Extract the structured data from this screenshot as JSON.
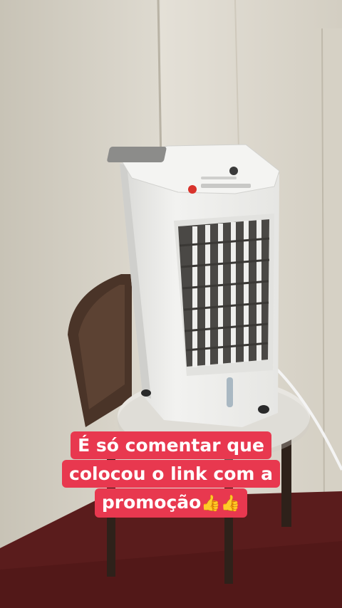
{
  "caption": {
    "line1": "É só comentar que",
    "line2": "colocou o link com a",
    "line3": "promoção",
    "emoji": "👍👍"
  },
  "colors": {
    "wall": "#dcd7cb",
    "wall_shadow": "#c9c2b3",
    "floor": "#5a1c1c",
    "device_body": "#f0f0ee",
    "grille": "#4a4845",
    "caption_bg": "#e8384f",
    "caption_text": "#ffffff"
  }
}
